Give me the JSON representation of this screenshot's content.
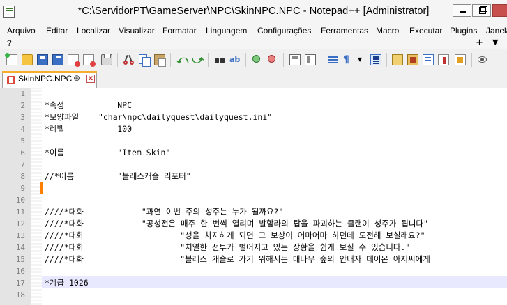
{
  "window": {
    "title": "*C:\\ServidorPT\\GameServer\\NPC\\SkinNPC.NPC - Notepad++ [Administrator]"
  },
  "menu": {
    "items": [
      "Arquivo",
      "Editar",
      "Localizar",
      "Visualizar",
      "Formatar",
      "Linguagem",
      "Configurações",
      "Ferramentas",
      "Macro",
      "Executar",
      "Plugins",
      "Janela"
    ],
    "help": "?",
    "plus": "+",
    "down": "▼"
  },
  "toolbar": {
    "icons": [
      "new-file-icon",
      "open-file-icon",
      "save-icon",
      "save-all-icon",
      "close-file-icon",
      "close-all-icon",
      "print-icon",
      "cut-icon",
      "copy-icon",
      "paste-icon",
      "undo-icon",
      "redo-icon",
      "find-icon",
      "replace-icon",
      "zoom-in-icon",
      "zoom-out-icon",
      "sync-vertical-icon",
      "sync-horizontal-icon",
      "word-wrap-icon",
      "show-all-chars-icon",
      "dropdown-icon",
      "indent-guide-icon",
      "user-language-icon",
      "doc-map-icon",
      "function-list-icon",
      "folder-workspace-icon",
      "record-macro-icon",
      "monitor-icon"
    ]
  },
  "tab": {
    "label": "SkinNPC.NPC",
    "pin": "⊕",
    "close": "x"
  },
  "editor": {
    "line_numbers": [
      "1",
      "2",
      "3",
      "4",
      "5",
      "6",
      "7",
      "8",
      "9",
      "10",
      "11",
      "12",
      "13",
      "14",
      "15",
      "16",
      "17",
      "18"
    ],
    "lines": [
      "",
      "*속성           NPC",
      "*모양파일    \"char\\npc\\dailyquest\\dailyquest.ini\"",
      "*레벨           100",
      "",
      "*이름           \"Item Skin\"",
      "",
      "//*이름         \"블레스캐슬 리포터\"",
      "",
      "",
      "////*대화            \"과연 이번 주의 성주는 누가 될까요?\"",
      "////*대화            \"공성전은 매주 한 번씩 열리며 발할라의 탑을 파괴하는 클랜이 성주가 됩니다\"",
      "////*대화                    \"성을 차지하게 되면 그 보상이 어마어마 하던데 도전해 보실래요?\"",
      "////*대화                    \"치열한 전투가 벌어지고 있는 상황을 쉽게 보실 수 있습니다.\"",
      "////*대화                    \"블레스 캐슬로 가기 위해서는 대나무 숲의 안내자 데이몬 아저씨에게",
      "",
      "*계급 1026",
      ""
    ]
  },
  "colors": {
    "current_line": "#e8e8ff",
    "gutter": "#e4e4e4",
    "change_marker": "#ff8000",
    "tab_accent": "#f7ae2e",
    "close_button": "#c7504c"
  }
}
